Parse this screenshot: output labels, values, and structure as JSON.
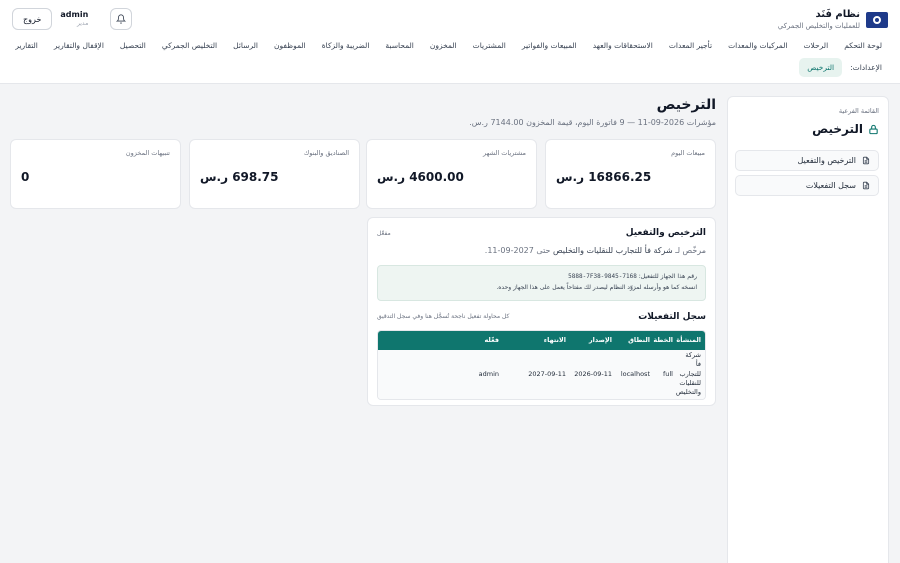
{
  "header": {
    "brand_title": "نظام فَنَد",
    "brand_subtitle": "للعمليات والتخليص الجمركي",
    "user_name": "admin",
    "user_role": "مدير",
    "logout_label": "خروج"
  },
  "nav": {
    "items": [
      "لوحة التحكم",
      "الرحلات",
      "المركبات والمعدات",
      "تأجير المعدات",
      "الاستحقاقات والعهد",
      "المبيعات والفواتير",
      "المشتريات",
      "المخزون",
      "المحاسبة",
      "الضريبة والزكاة",
      "الموظفون",
      "الرسائل",
      "التخليص الجمركي",
      "التحصيل",
      "الإقفال والتقارير",
      "التقارير"
    ]
  },
  "subnav": {
    "section_label": "الإعدادات:",
    "active_tab": "الترخيص"
  },
  "side": {
    "caption": "القائمة الفرعية",
    "title": "الترخيص",
    "items": [
      "الترخيص والتفعيل",
      "سجل التفعيلات"
    ]
  },
  "page": {
    "title": "الترخيص",
    "subtitle": "مؤشرات 2026-09-11 — 9 فاتورة اليوم، قيمة المخزون 7144.00 ر.س."
  },
  "stats": [
    {
      "label": "مبيعات اليوم",
      "value": "16866.25 ر.س"
    },
    {
      "label": "مشتريات الشهر",
      "value": "4600.00 ر.س"
    },
    {
      "label": "الصناديق والبنوك",
      "value": "698.75 ر.س"
    },
    {
      "label": "تنبيهات المخزون",
      "value": "0"
    }
  ],
  "license": {
    "title": "الترخيص والتفعيل",
    "status": "مفعّل",
    "licensed_prefix": "مرخّص لـ",
    "company": "شركة فأ للتجارب للنقليات والتخليص",
    "until": "حتى 2027-09-11.",
    "device_label": "رقم هذا الجهاز للتفعيل:",
    "device_code": "5888-7F38-9845-7168",
    "device_note": "انسخه كما هو وأرسله لمزوّد النظام ليصدر لك مفتاحاً يعمل على هذا الجهاز وحده."
  },
  "activations": {
    "title": "سجل التفعيلات",
    "note": "كل محاولة تفعيل ناجحة تُسجَّل هنا وفي سجل التدقيق",
    "columns": [
      "المنشأة",
      "الخطة",
      "النطاق",
      "الإصدار",
      "الانتهاء",
      "فعّله"
    ],
    "rows": [
      {
        "company": "شركة فأ للتجارب للنقليات والتخليص",
        "plan": "full",
        "scope": "localhost",
        "issued": "2026-09-11",
        "expires": "2027-09-11",
        "by": "admin"
      }
    ]
  },
  "colors": {
    "accent": "#0f766e",
    "accent_light": "#e7f3ef",
    "brand": "#1e3a8a"
  }
}
